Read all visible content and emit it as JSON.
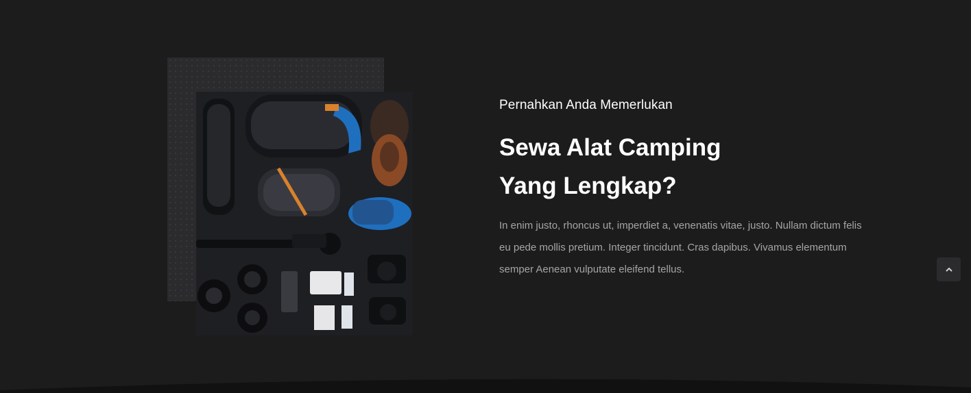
{
  "about": {
    "eyebrow": "Pernahkan Anda Memerlukan",
    "headline_line1": "Sewa Alat Camping",
    "headline_line2": "Yang Lengkap?",
    "paragraph": "In enim justo, rhoncus ut, imperdiet a, venenatis vitae, justo. Nullam dictum felis eu pede mollis pretium. Integer tincidunt. Cras dapibus. Vivamus elementum semper Aenean vulputate eleifend tellus."
  },
  "photo": {
    "subject": "flat-lay camping gear: sleeping bags, boots, tripod, cameras, lenses, batteries"
  },
  "back_to_top": {
    "icon": "chevron-up-icon"
  },
  "colors": {
    "background": "#1c1c1d",
    "panel": "#2b2b2d",
    "heading": "#ffffff",
    "body_text": "#a7a4a6",
    "accent_blue": "#1f6fbf",
    "accent_orange": "#d9822b"
  }
}
